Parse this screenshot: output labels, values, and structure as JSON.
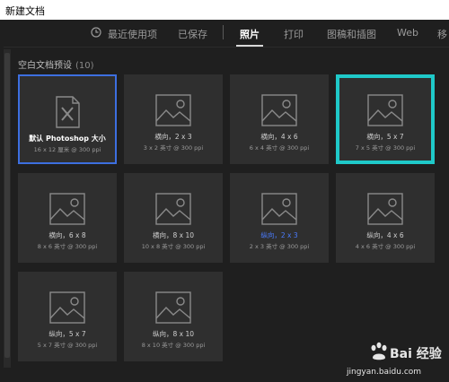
{
  "window": {
    "title": "新建文档"
  },
  "tabs": [
    {
      "label": "最近使用项"
    },
    {
      "label": "已保存"
    },
    {
      "label": "照片",
      "active": true
    },
    {
      "label": "打印"
    },
    {
      "label": "图稿和插图"
    },
    {
      "label": "Web"
    },
    {
      "label": "移"
    }
  ],
  "section": {
    "title": "空白文档预设",
    "count": "(10)"
  },
  "presets": [
    {
      "name": "默认 Photoshop 大小",
      "dims": "16 x 12 厘米 @ 300 ppi",
      "icon": "document-brush-icon",
      "state": "selected"
    },
    {
      "name": "横向，2 x 3",
      "dims": "3 x 2 英寸 @ 300 ppi",
      "icon": "image-icon",
      "state": ""
    },
    {
      "name": "横向，4 x 6",
      "dims": "6 x 4 英寸 @ 300 ppi",
      "icon": "image-icon",
      "state": ""
    },
    {
      "name": "横向，5 x 7",
      "dims": "7 x 5 英寸 @ 300 ppi",
      "icon": "image-icon",
      "state": "highlight"
    },
    {
      "name": "横向，6 x 8",
      "dims": "8 x 6 英寸 @ 300 ppi",
      "icon": "image-icon",
      "state": ""
    },
    {
      "name": "横向，8 x 10",
      "dims": "10 x 8 英寸 @ 300 ppi",
      "icon": "image-icon",
      "state": ""
    },
    {
      "name": "纵向，2 x 3",
      "dims": "2 x 3 英寸 @ 300 ppi",
      "icon": "image-icon",
      "state": "hover"
    },
    {
      "name": "纵向，4 x 6",
      "dims": "4 x 6 英寸 @ 300 ppi",
      "icon": "image-icon",
      "state": ""
    },
    {
      "name": "纵向，5 x 7",
      "dims": "5 x 7 英寸 @ 300 ppi",
      "icon": "image-icon",
      "state": ""
    },
    {
      "name": "纵向，8 x 10",
      "dims": "8 x 10 英寸 @ 300 ppi",
      "icon": "image-icon",
      "state": ""
    }
  ],
  "watermark": {
    "brand": "Bai 经验",
    "url": "jingyan.baidu.com"
  },
  "colors": {
    "selected_border": "#3d6fe0",
    "highlight_border": "#1fc9c9",
    "hover_text": "#4a7cff"
  }
}
